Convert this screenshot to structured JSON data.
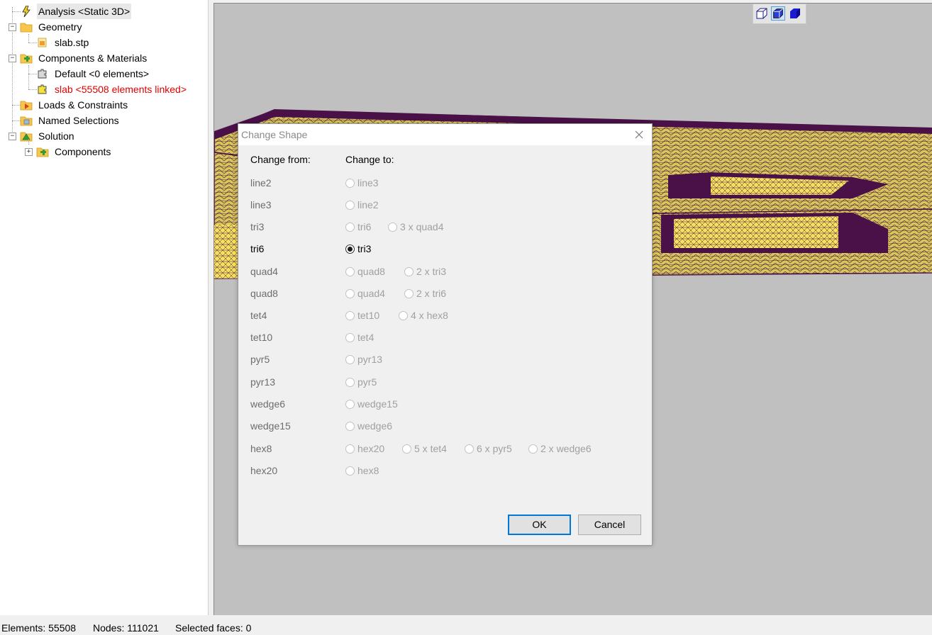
{
  "tree": {
    "analysis": "Analysis <Static 3D>",
    "geometry": "Geometry",
    "geometry_file": "slab.stp",
    "components_materials": "Components & Materials",
    "default_component": "Default <0 elements>",
    "slab_component": "slab <55508 elements linked>",
    "loads_constraints": "Loads & Constraints",
    "named_selections": "Named Selections",
    "solution": "Solution",
    "solution_components": "Components"
  },
  "view_toolbar": {
    "buttons": [
      "wireframe-cube-icon",
      "shaded-edges-cube-icon",
      "solid-cube-icon"
    ],
    "active": "shaded-edges-cube-icon"
  },
  "dialog": {
    "title": "Change Shape",
    "col_from": "Change from:",
    "col_to": "Change to:",
    "rows": [
      {
        "from": "line2",
        "options": [
          "line3"
        ],
        "enabled": false
      },
      {
        "from": "line3",
        "options": [
          "line2"
        ],
        "enabled": false
      },
      {
        "from": "tri3",
        "options": [
          "tri6",
          "3 x quad4"
        ],
        "enabled": false
      },
      {
        "from": "tri6",
        "options": [
          "tri3"
        ],
        "enabled": true,
        "selected": "tri3"
      },
      {
        "from": "quad4",
        "options": [
          "quad8",
          "2 x tri3"
        ],
        "enabled": false
      },
      {
        "from": "quad8",
        "options": [
          "quad4",
          "2 x tri6"
        ],
        "enabled": false
      },
      {
        "from": "tet4",
        "options": [
          "tet10",
          "4 x hex8"
        ],
        "enabled": false
      },
      {
        "from": "tet10",
        "options": [
          "tet4"
        ],
        "enabled": false
      },
      {
        "from": "pyr5",
        "options": [
          "pyr13"
        ],
        "enabled": false
      },
      {
        "from": "pyr13",
        "options": [
          "pyr5"
        ],
        "enabled": false
      },
      {
        "from": "wedge6",
        "options": [
          "wedge15"
        ],
        "enabled": false
      },
      {
        "from": "wedge15",
        "options": [
          "wedge6"
        ],
        "enabled": false
      },
      {
        "from": "hex8",
        "options": [
          "hex20",
          "5 x tet4",
          "6 x pyr5",
          "2 x wedge6"
        ],
        "enabled": false
      },
      {
        "from": "hex20",
        "options": [
          "hex8"
        ],
        "enabled": false
      }
    ],
    "ok_label": "OK",
    "cancel_label": "Cancel"
  },
  "status": {
    "elements": "Elements: 55508",
    "nodes": "Nodes: 111021",
    "selected_faces": "Selected faces: 0"
  },
  "colors": {
    "mesh_fill": "#d8c85a",
    "mesh_edge": "#4a1048",
    "viewport_bg": "#c0c0c0",
    "linked_red": "#e00000",
    "accent_blue": "#0078d7"
  }
}
